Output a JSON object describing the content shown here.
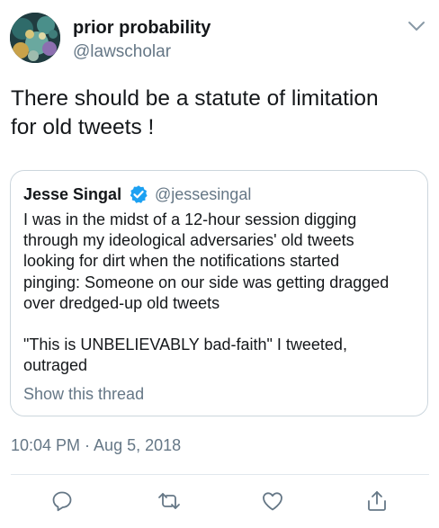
{
  "tweet": {
    "author": {
      "display_name": "prior probability",
      "handle": "@lawscholar"
    },
    "text_lines": [
      "There should be a statute of limitation",
      "for old tweets !"
    ],
    "timestamp": "10:04 PM · Aug 5, 2018"
  },
  "quoted_tweet": {
    "author": {
      "display_name": "Jesse Singal",
      "handle": "@jessesingal",
      "verified": true
    },
    "paragraph1_lines": [
      "I was in the midst of a 12-hour session digging",
      "through my ideological adversaries' old tweets",
      "looking for dirt when the notifications started",
      "pinging: Someone on our side was getting dragged",
      "over dredged-up old tweets"
    ],
    "paragraph2_lines": [
      "\"This is UNBELIEVABLY bad-faith\" I tweeted,",
      "outraged"
    ],
    "show_thread_label": "Show this thread"
  },
  "actions": [
    {
      "name": "reply",
      "icon": "reply-icon"
    },
    {
      "name": "retweet",
      "icon": "retweet-icon"
    },
    {
      "name": "like",
      "icon": "heart-icon"
    },
    {
      "name": "share",
      "icon": "share-icon"
    }
  ],
  "colors": {
    "text_primary": "#14171a",
    "text_secondary": "#657786",
    "verified_blue": "#1da1f2",
    "border": "#ccd6dd"
  }
}
